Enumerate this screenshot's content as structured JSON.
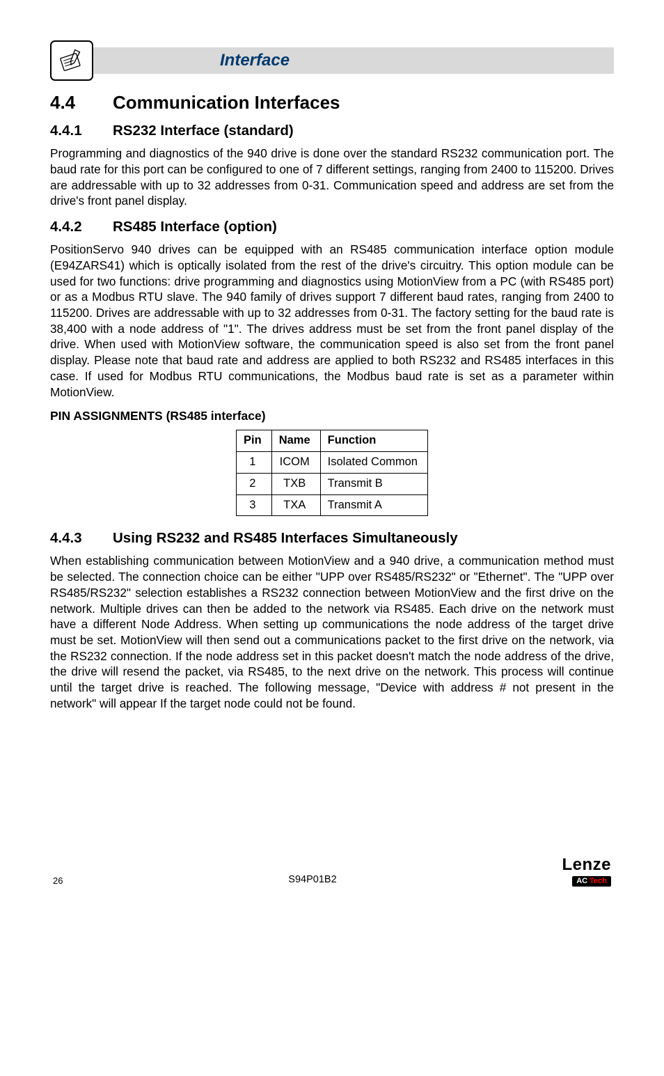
{
  "banner_title": "Interface",
  "section": {
    "num": "4.4",
    "title": "Communication Interfaces"
  },
  "sub1": {
    "num": "4.4.1",
    "title": "RS232 Interface (standard)",
    "para": "Programming and diagnostics of the 940 drive is done over the standard RS232 communication port. The baud rate for this port can be configured to one of 7 different settings, ranging from 2400 to 115200. Drives are addressable with up to 32 addresses from 0-31. Communication speed and address are set from the drive's front panel display."
  },
  "sub2": {
    "num": "4.4.2",
    "title": "RS485 Interface (option)",
    "para": "PositionServo 940 drives can be equipped with an RS485 communication interface option module (E94ZARS41) which is optically isolated from the rest of the drive's circuitry. This option module can be used for two functions: drive programming and diagnostics using MotionView from a PC (with RS485 port) or as a Modbus RTU slave. The 940 family of drives support 7 different baud rates, ranging from 2400 to 115200. Drives are addressable with up to 32 addresses from 0-31. The factory setting for the baud rate is 38,400 with a node address of \"1\". The drives address must be set from the front panel display of the drive. When used with MotionView software, the communication speed is also set from the front panel display. Please note that baud rate and address are applied to both RS232 and RS485 interfaces in this case. If used for Modbus RTU communications, the Modbus baud rate is set as a parameter within MotionView."
  },
  "table_title": "PIN ASSIGNMENTS (RS485 interface)",
  "table": {
    "headers": {
      "c1": "Pin",
      "c2": "Name",
      "c3": "Function"
    },
    "rows": [
      {
        "pin": "1",
        "name": "ICOM",
        "func": "Isolated Common"
      },
      {
        "pin": "2",
        "name": "TXB",
        "func": "Transmit B"
      },
      {
        "pin": "3",
        "name": "TXA",
        "func": "Transmit A"
      }
    ]
  },
  "sub3": {
    "num": "4.4.3",
    "title": "Using RS232 and RS485 Interfaces Simultaneously",
    "para": "When establishing communication between MotionView and a 940 drive, a communication method must be selected. The connection choice can be either \"UPP over RS485/RS232\" or \"Ethernet\". The \"UPP over RS485/RS232\" selection establishes a RS232 connection between MotionView and the first drive on the network. Multiple drives can then be added to the network via RS485.  Each drive on the network must have a different Node Address. When setting up communications the node address of the target drive must be set. MotionView will then send out a communications packet to the first drive on the network, via the RS232 connection. If the node address set in this packet doesn't match the node address of the drive, the drive will resend the packet, via RS485, to the next drive on the network. This process will continue until the target drive is reached. The following message, \"Device with address # not present in the network\" will appear If the target node could not be found."
  },
  "footer": {
    "page": "26",
    "doc": "S94P01B2",
    "brand": "Lenze",
    "subbrand_ac": "AC",
    "subbrand_tech": " Tech"
  }
}
